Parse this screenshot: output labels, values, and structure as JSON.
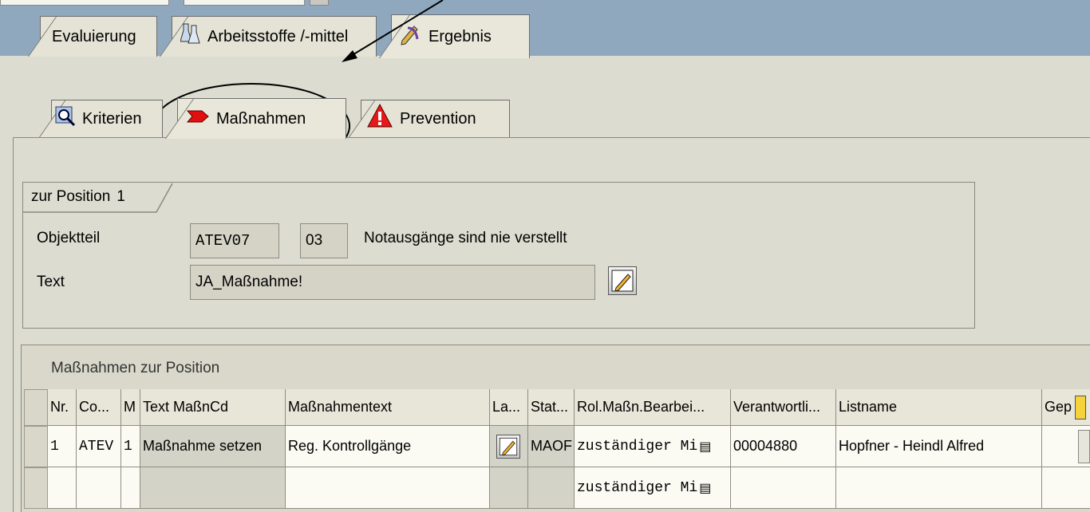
{
  "main_tabs": [
    {
      "label": "Evaluierung"
    },
    {
      "label": "Arbeitsstoffe /-mittel"
    },
    {
      "label": "Ergebnis"
    }
  ],
  "sub_tabs": [
    {
      "label": "Kriterien"
    },
    {
      "label": "Maßnahmen"
    },
    {
      "label": "Prevention"
    }
  ],
  "position_box": {
    "title": "zur Position",
    "number": "1",
    "objektteil_label": "Objektteil",
    "objektteil_code": "ATEV07",
    "objektteil_nr": "03",
    "objektteil_desc": "Notausgänge sind nie verstellt",
    "text_label": "Text",
    "text_value": "JA_Maßnahme!"
  },
  "measures": {
    "title": "Maßnahmen zur Position",
    "columns": [
      "Nr.",
      "Co...",
      "M",
      "Text MaßnCd",
      "Maßnahmentext",
      "La...",
      "Stat...",
      "Rol.Maßn.Bearbei...",
      "Verantwortli...",
      "Listname",
      "Gep"
    ],
    "rows": [
      {
        "nr": "1",
        "co": "ATEV",
        "m": "1",
        "text": "Maßnahme setzen",
        "massnahmentext": "Reg. Kontrollgänge",
        "stat": "MAOF",
        "rolle": "zuständiger Mi",
        "verantwortlich": "00004880",
        "listname": "Hopfner - Heindl Alfred"
      },
      {
        "nr": "",
        "co": "",
        "m": "",
        "text": "",
        "massnahmentext": "",
        "stat": "",
        "rolle": "zuständiger Mi",
        "verantwortlich": "",
        "listname": ""
      }
    ]
  },
  "colors": {
    "header_bar": "#8fa8bd",
    "background": "#dcdcd0",
    "row": "#fbfbf4"
  }
}
